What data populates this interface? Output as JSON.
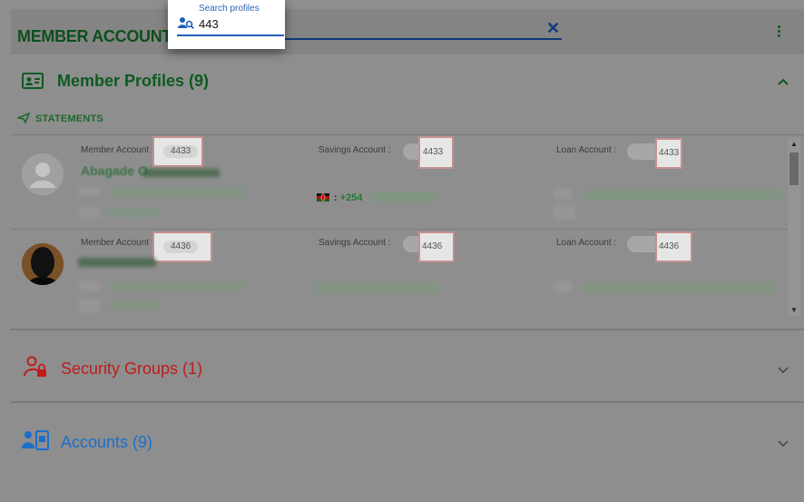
{
  "topbar": {
    "title": "MEMBER ACCOUNTS",
    "close_symbol": "✕"
  },
  "search": {
    "label": "Search profiles",
    "value": "443"
  },
  "member_profiles": {
    "title": "Member Profiles (9)"
  },
  "statements_label": "STATEMENTS",
  "rows": [
    {
      "member_account_label": "Member Account :",
      "member_account": "4433",
      "savings_account_label": "Savings Account :",
      "savings_account": "4433",
      "loan_account_label": "Loan Account :",
      "loan_account": "4433",
      "name": "Abagade O",
      "phone": "+254"
    },
    {
      "member_account_label": "Member Account :",
      "member_account": "4436",
      "savings_account_label": "Savings Account :",
      "savings_account": "4436",
      "loan_account_label": "Loan Account :",
      "loan_account": "4436"
    }
  ],
  "security_groups": {
    "title": "Security Groups (1)"
  },
  "accounts": {
    "title": "Accounts (9)"
  },
  "colors": {
    "green": "#0d5a20",
    "red": "#c01b1b",
    "blue": "#1c6fc9"
  }
}
